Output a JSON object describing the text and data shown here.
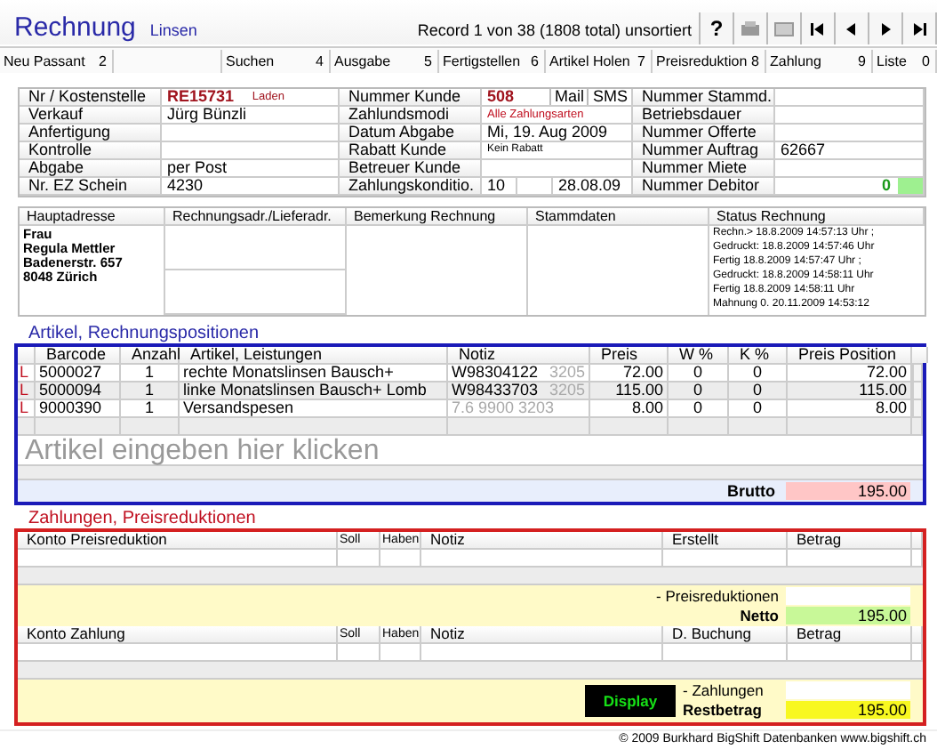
{
  "header": {
    "title": "Rechnung",
    "subtitle": "Linsen",
    "record": "Record 1 von 38 (1808 total) unsortiert",
    "help": "?"
  },
  "toolbar": [
    {
      "label": "Neu Passant",
      "key": "2"
    },
    {
      "kind": "blank"
    },
    {
      "label": "Suchen",
      "key": "4"
    },
    {
      "label": "Ausgabe",
      "key": "5"
    },
    {
      "label": "Fertigstellen",
      "key": "6"
    },
    {
      "label": "Artikel Holen",
      "key": "7"
    },
    {
      "label": "Preisreduktion",
      "key": "8"
    },
    {
      "label": "Zahlung",
      "key": "9"
    },
    {
      "label": "Liste",
      "key": "0"
    }
  ],
  "info": [
    {
      "label": "Nr / Kostenstelle",
      "kind": "ref",
      "value": "RE15731",
      "tag": "Laden"
    },
    {
      "label": "Nummer Kunde",
      "kind": "customer",
      "value": "508",
      "buttons": [
        "Mail",
        "SMS"
      ]
    },
    {
      "label": "Nummer Stammd.",
      "kind": "text"
    },
    {
      "label": "Verkauf",
      "kind": "text",
      "value": "Jürg Bünzli"
    },
    {
      "label": "Zahlundsmodi",
      "kind": "note",
      "value": "Alle Zahlungsarten"
    },
    {
      "label": "Betriebsdauer",
      "kind": "text"
    },
    {
      "label": "Anfertigung",
      "kind": "text"
    },
    {
      "label": "Datum Abgabe",
      "kind": "text",
      "value": "Mi, 19. Aug 2009"
    },
    {
      "label": "Nummer Offerte",
      "kind": "text"
    },
    {
      "label": "Kontrolle",
      "kind": "text"
    },
    {
      "label": "Rabatt Kunde",
      "kind": "small",
      "value": "Kein Rabatt"
    },
    {
      "label": "Nummer Auftrag",
      "kind": "text",
      "value": "62667"
    },
    {
      "label": "Abgabe",
      "kind": "text",
      "value": "per Post"
    },
    {
      "label": "Betreuer Kunde",
      "kind": "text"
    },
    {
      "label": "Nummer Miete",
      "kind": "text"
    },
    {
      "label": "Nr. EZ Schein",
      "kind": "text",
      "value": "4230"
    },
    {
      "label": "Zahlungskonditio.",
      "kind": "terms",
      "parts": [
        "10",
        "28.08.09"
      ]
    },
    {
      "label": "Nummer Debitor",
      "kind": "debitor",
      "value": "0"
    }
  ],
  "address": {
    "columns": [
      "Hauptadresse",
      "Rechnungsadr./Lieferadr.",
      "Bemerkung Rechnung",
      "Stammdaten",
      "Status Rechnung"
    ],
    "lines": [
      "Frau",
      "Regula Mettler",
      "Badenerstr. 657",
      "8048 Zürich"
    ],
    "status": [
      "Rechn.> 18.8.2009 14:57:13 Uhr ;",
      "Gedruckt: 18.8.2009 14:57:46 Uhr",
      "Fertig 18.8.2009 14:57:47 Uhr ;",
      "Gedruckt: 18.8.2009 14:58:11 Uhr",
      "Fertig 18.8.2009 14:58:11 Uhr",
      "Mahnung 0. 20.11.2009 14:53:12"
    ]
  },
  "items": {
    "title": "Artikel, Rechnungspositionen",
    "columns": [
      "Barcode",
      "Anzahl",
      "Artikel, Leistungen",
      "Notiz",
      "Preis",
      "W %",
      "K %",
      "Preis Position"
    ],
    "rows": [
      {
        "flag": "L",
        "barcode": "5000027",
        "qty": "1",
        "article": "rechte Monatslinsen Bausch+",
        "notiz": "W98304122",
        "code": "3205",
        "price": "72.00",
        "w": "0",
        "k": "0",
        "total": "72.00"
      },
      {
        "flag": "L",
        "barcode": "5000094",
        "qty": "1",
        "article": "linke Monatslinsen Bausch+ Lomb",
        "notiz": "W98433703",
        "code": "3205",
        "price": "115.00",
        "w": "0",
        "k": "0",
        "total": "115.00"
      },
      {
        "flag": "L",
        "barcode": "9000390",
        "qty": "1",
        "article": "Versandspesen",
        "code": "7.6    9900    3203",
        "price": "8.00",
        "w": "0",
        "k": "0",
        "total": "8.00"
      }
    ],
    "placeholder": "Artikel eingeben hier klicken",
    "brutto_label": "Brutto",
    "brutto": "195.00"
  },
  "payments": {
    "title": "Zahlungen, Preisreduktionen",
    "reductions": {
      "columns": [
        "Konto Preisreduktion",
        "Soll",
        "Haben",
        "Notiz",
        "Erstellt",
        "Betrag"
      ],
      "sum_label": "- Preisreduktionen",
      "total_label": "Netto",
      "total": "195.00"
    },
    "payments": {
      "columns": [
        "Konto Zahlung",
        "Soll",
        "Haben",
        "Notiz",
        "D. Buchung",
        "Betrag"
      ],
      "sum_label": "- Zahlungen",
      "total_label": "Restbetrag",
      "total": "195.00"
    },
    "display_button": "Display"
  },
  "footer": "© 2009 Burkhard BigShift Datenbanken www.bigshift.ch"
}
